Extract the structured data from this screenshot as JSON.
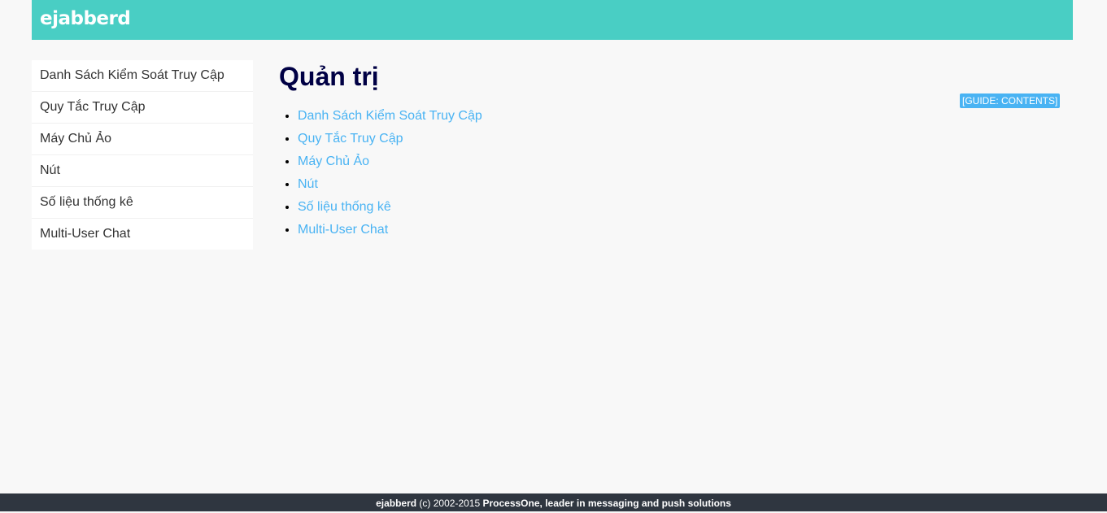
{
  "header": {
    "logo_text": "ejabberd"
  },
  "sidebar": {
    "items": [
      {
        "label": "Danh Sách Kiểm Soát Truy Cập"
      },
      {
        "label": "Quy Tắc Truy Cập"
      },
      {
        "label": "Máy Chủ Ảo"
      },
      {
        "label": "Nút"
      },
      {
        "label": "Số liệu thống kê"
      },
      {
        "label": "Multi-User Chat"
      }
    ]
  },
  "main": {
    "title": "Quản trị",
    "guide_link": "[GUIDE: CONTENTS]",
    "links": [
      {
        "label": "Danh Sách Kiểm Soát Truy Cập"
      },
      {
        "label": "Quy Tắc Truy Cập"
      },
      {
        "label": "Máy Chủ Ảo"
      },
      {
        "label": "Nút"
      },
      {
        "label": "Số liệu thống kê"
      },
      {
        "label": "Multi-User Chat"
      }
    ]
  },
  "footer": {
    "product": "ejabberd",
    "copyright": " (c) 2002-2015 ",
    "company": "ProcessOne, leader in messaging and push solutions"
  },
  "colors": {
    "header_bg": "#49cec4",
    "link": "#49b3f3",
    "title": "#000044",
    "footer_bg": "#2f3640"
  }
}
